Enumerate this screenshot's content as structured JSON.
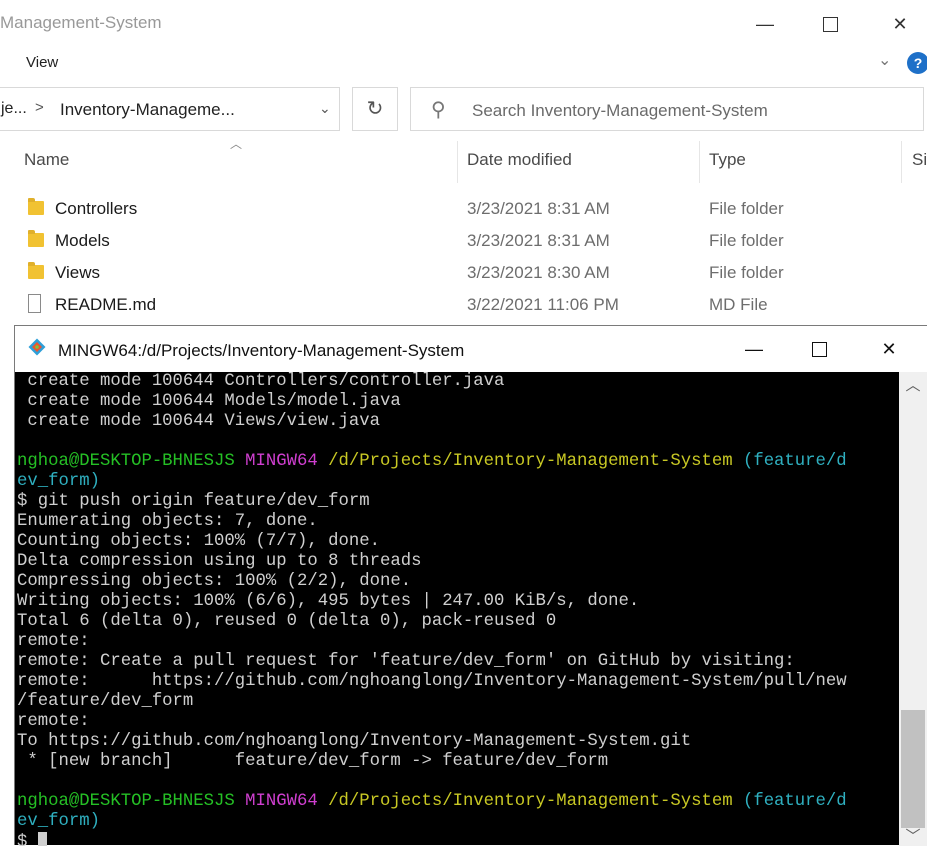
{
  "explorer": {
    "title": "Management-System",
    "ribbon_tab": "View",
    "help_label": "?",
    "address": {
      "prev_fragment": "je...",
      "separator": ">",
      "current": "Inventory-Manageme...",
      "dropdown": "⌄"
    },
    "refresh_icon": "↻",
    "search_placeholder": "Search Inventory-Management-System",
    "columns": [
      "Name",
      "Date modified",
      "Type",
      "Si"
    ],
    "files": [
      {
        "name": "Controllers",
        "date": "3/23/2021 8:31 AM",
        "type": "File folder",
        "icon": "folder-icon"
      },
      {
        "name": "Models",
        "date": "3/23/2021 8:31 AM",
        "type": "File folder",
        "icon": "folder-icon"
      },
      {
        "name": "Views",
        "date": "3/23/2021 8:30 AM",
        "type": "File folder",
        "icon": "folder-icon"
      },
      {
        "name": "README.md",
        "date": "3/22/2021 11:06 PM",
        "type": "MD File",
        "icon": "file-icon"
      }
    ]
  },
  "terminal": {
    "title": "MINGW64:/d/Projects/Inventory-Management-System",
    "lines": [
      [
        {
          "t": " create mode 100644 Controllers/controller.java",
          "c": ""
        }
      ],
      [
        {
          "t": " create mode 100644 Models/model.java",
          "c": ""
        }
      ],
      [
        {
          "t": " create mode 100644 Views/view.java",
          "c": ""
        }
      ],
      [
        {
          "t": "",
          "c": ""
        }
      ],
      [
        {
          "t": "nghoa@DESKTOP-BHNESJS",
          "c": "g"
        },
        {
          "t": " ",
          "c": ""
        },
        {
          "t": "MINGW64",
          "c": "m"
        },
        {
          "t": " ",
          "c": ""
        },
        {
          "t": "/d/Projects/Inventory-Management-System",
          "c": "y"
        },
        {
          "t": " (feature/d",
          "c": "c"
        }
      ],
      [
        {
          "t": "ev_form)",
          "c": "c"
        }
      ],
      [
        {
          "t": "$ git push origin feature/dev_form",
          "c": ""
        }
      ],
      [
        {
          "t": "Enumerating objects: 7, done.",
          "c": ""
        }
      ],
      [
        {
          "t": "Counting objects: 100% (7/7), done.",
          "c": ""
        }
      ],
      [
        {
          "t": "Delta compression using up to 8 threads",
          "c": ""
        }
      ],
      [
        {
          "t": "Compressing objects: 100% (2/2), done.",
          "c": ""
        }
      ],
      [
        {
          "t": "Writing objects: 100% (6/6), 495 bytes | 247.00 KiB/s, done.",
          "c": ""
        }
      ],
      [
        {
          "t": "Total 6 (delta 0), reused 0 (delta 0), pack-reused 0",
          "c": ""
        }
      ],
      [
        {
          "t": "remote:",
          "c": ""
        }
      ],
      [
        {
          "t": "remote: Create a pull request for 'feature/dev_form' on GitHub by visiting:",
          "c": ""
        }
      ],
      [
        {
          "t": "remote:      https://github.com/nghoanglong/Inventory-Management-System/pull/new",
          "c": ""
        }
      ],
      [
        {
          "t": "/feature/dev_form",
          "c": ""
        }
      ],
      [
        {
          "t": "remote:",
          "c": ""
        }
      ],
      [
        {
          "t": "To https://github.com/nghoanglong/Inventory-Management-System.git",
          "c": ""
        }
      ],
      [
        {
          "t": " * [new branch]      feature/dev_form -> feature/dev_form",
          "c": ""
        }
      ],
      [
        {
          "t": "",
          "c": ""
        }
      ],
      [
        {
          "t": "nghoa@DESKTOP-BHNESJS",
          "c": "g"
        },
        {
          "t": " ",
          "c": ""
        },
        {
          "t": "MINGW64",
          "c": "m"
        },
        {
          "t": " ",
          "c": ""
        },
        {
          "t": "/d/Projects/Inventory-Management-System",
          "c": "y"
        },
        {
          "t": " (feature/d",
          "c": "c"
        }
      ],
      [
        {
          "t": "ev_form)",
          "c": "c"
        }
      ],
      [
        {
          "t": "$ ",
          "c": ""
        }
      ]
    ]
  },
  "colors": {
    "terminal_bg": "#000000",
    "prompt_user": "#25c025",
    "prompt_system": "#d03fd0",
    "prompt_path": "#c8c824",
    "prompt_branch": "#2fb0c0",
    "help_blue": "#1e70c8",
    "folder_yellow": "#f1c232"
  }
}
